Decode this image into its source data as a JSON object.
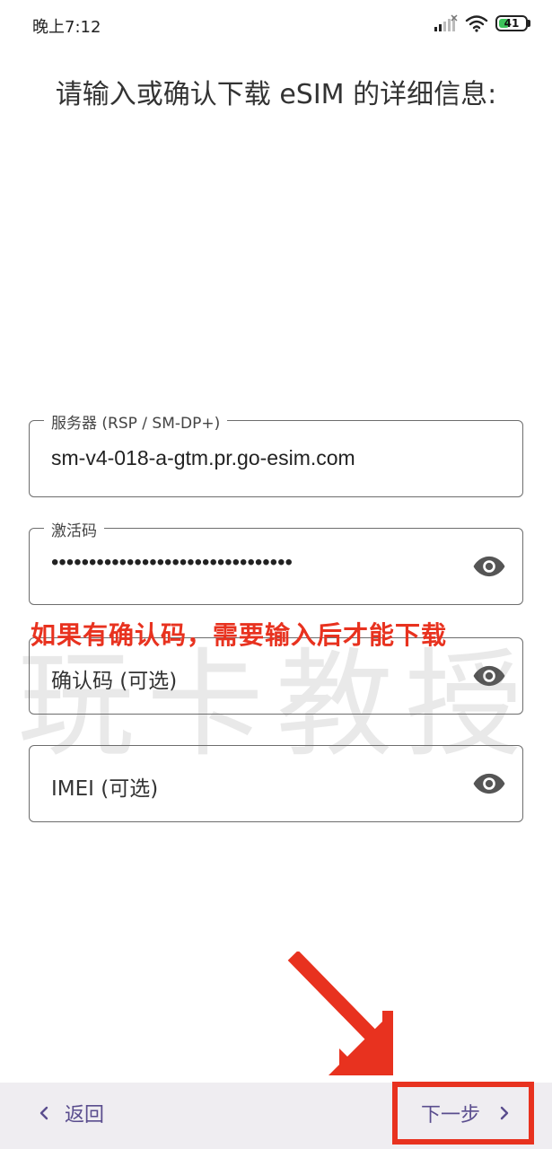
{
  "status_bar": {
    "time": "晚上7:12",
    "battery_level": "41",
    "battery_fraction": 0.41,
    "icons": [
      "signal-icon",
      "wifi-icon",
      "battery-icon"
    ]
  },
  "page": {
    "title": "请输入或确认下载 eSIM 的详细信息:"
  },
  "fields": {
    "server": {
      "label": "服务器 (RSP / SM-DP+)",
      "value": "sm-v4-018-a-gtm.pr.go-esim.com"
    },
    "activation_code": {
      "label": "激活码",
      "value": "••••••••••••••••••••••••••••••••"
    },
    "confirmation_code": {
      "placeholder": "确认码 (可选)"
    },
    "imei": {
      "placeholder": "IMEI (可选)"
    }
  },
  "annotation": {
    "text": "如果有确认码，需要输入后才能下载",
    "watermark": "玩卡教授",
    "color": "#e8321f"
  },
  "navigation": {
    "back_label": "返回",
    "next_label": "下一步"
  },
  "colors": {
    "accent": "#5a4d8e",
    "annotation": "#e8321f",
    "bottom_bar": "#efedf1"
  }
}
